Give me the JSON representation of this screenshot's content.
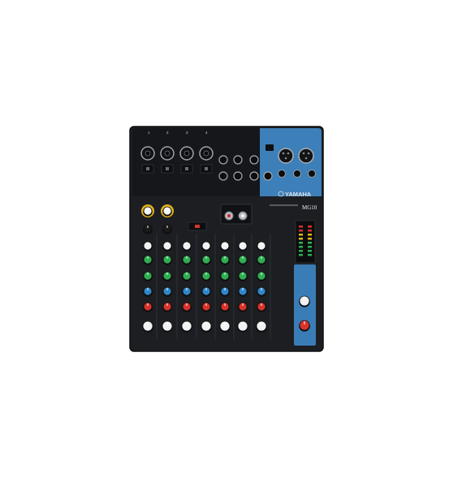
{
  "product": {
    "brand": "YAMAHA",
    "model": "MG10",
    "channel_numbers": [
      "1",
      "2",
      "3",
      "4"
    ]
  },
  "colors": {
    "body": "#1c1e22",
    "blue_panel": "#3d7fb8",
    "knob_white": "#f2f2f2",
    "knob_green": "#2fae52",
    "knob_blue": "#2f86c9",
    "knob_red": "#d8332a",
    "knob_yellow": "#e2b418"
  },
  "icons": [
    "xlr-input-icon",
    "jack-input-icon",
    "rca-jack-icon",
    "knob-icon",
    "led-meter-icon"
  ]
}
